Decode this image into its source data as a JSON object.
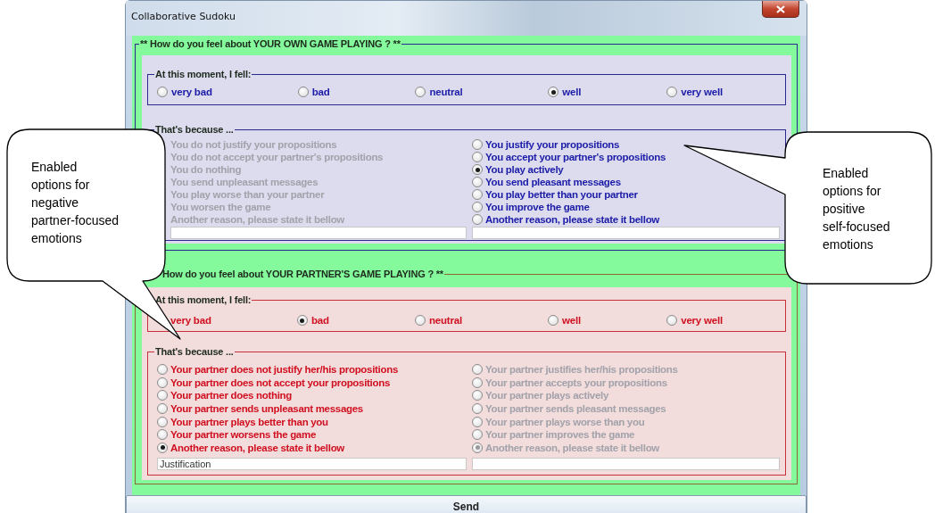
{
  "window": {
    "title": "Collaborative Sudoku"
  },
  "sections": [
    {
      "kind": "own",
      "title": "** How do you feel about YOUR OWN GAME PLAYING ?  **",
      "feeling": {
        "title": "At this moment, I fell:",
        "options": [
          {
            "label": "very bad",
            "selected": false
          },
          {
            "label": "bad",
            "selected": false
          },
          {
            "label": "neutral",
            "selected": false
          },
          {
            "label": "well",
            "selected": true
          },
          {
            "label": "very well",
            "selected": false
          }
        ]
      },
      "reasons": {
        "title": "That's because ...",
        "columns": [
          {
            "items": [
              {
                "label": "You do not justify your propositions",
                "enabled": false
              },
              {
                "label": "You do not accept your partner's propositions",
                "enabled": false
              },
              {
                "label": "You do nothing",
                "enabled": false
              },
              {
                "label": "You send unpleasant messages",
                "enabled": false
              },
              {
                "label": "You play worse than your partner",
                "enabled": false
              },
              {
                "label": "You worsen the game",
                "enabled": false
              },
              {
                "label": "Another reason, please state it bellow",
                "enabled": false
              }
            ]
          },
          {
            "items": [
              {
                "label": "You justify your propositions",
                "enabled": true,
                "selected": false
              },
              {
                "label": "You accept your partner's propositions",
                "enabled": true,
                "selected": false
              },
              {
                "label": "You play actively",
                "enabled": true,
                "selected": true
              },
              {
                "label": "You send pleasant messages",
                "enabled": true,
                "selected": false
              },
              {
                "label": "You play better than your partner",
                "enabled": true,
                "selected": false
              },
              {
                "label": "You improve the game",
                "enabled": true,
                "selected": false
              },
              {
                "label": "Another reason, please state it bellow",
                "enabled": true,
                "selected": false
              }
            ]
          }
        ]
      }
    },
    {
      "kind": "partner",
      "title": "How do you feel about YOUR PARTNER'S GAME PLAYING ?  **",
      "feeling": {
        "title": "At this moment, I fell:",
        "options": [
          {
            "label": "very bad"
          },
          {
            "label": "bad",
            "selected": true
          },
          {
            "label": "neutral",
            "selected": false
          },
          {
            "label": "well",
            "selected": false
          },
          {
            "label": "very well",
            "selected": false
          }
        ]
      },
      "reasons": {
        "title": "That's because ...",
        "columns": [
          {
            "items": [
              {
                "label": "Your partner does not justify her/his propositions",
                "enabled": true,
                "selected": false
              },
              {
                "label": "Your partner does not accept your propositions",
                "enabled": true,
                "selected": false
              },
              {
                "label": "Your partner does nothing",
                "enabled": true,
                "selected": false
              },
              {
                "label": "Your partner sends unpleasant messages",
                "enabled": true,
                "selected": false
              },
              {
                "label": "Your partner plays better than you",
                "enabled": true,
                "selected": false
              },
              {
                "label": "Your partner worsens the game",
                "enabled": true,
                "selected": false
              },
              {
                "label": "Another reason, please state it bellow",
                "enabled": true,
                "selected": true
              }
            ],
            "field": {
              "value": "Justification"
            }
          },
          {
            "items": [
              {
                "label": "Your partner justifies her/his propositions",
                "enabled": false,
                "selected": false
              },
              {
                "label": "Your partner accepts your propositions",
                "enabled": false,
                "selected": false
              },
              {
                "label": "Your partner plays actively",
                "enabled": false,
                "selected": false
              },
              {
                "label": "Your partner sends pleasant messages",
                "enabled": false,
                "selected": false
              },
              {
                "label": "Your partner plays worse than you",
                "enabled": false,
                "selected": false
              },
              {
                "label": "Your partner improves the game",
                "enabled": false,
                "selected": false
              },
              {
                "label": "Another reason, please state it bellow",
                "enabled": false,
                "selected": true
              }
            ]
          }
        ]
      }
    }
  ],
  "send_button": "Send",
  "callouts": [
    {
      "text": "Enabled\noptions for\nnegative\npartner-focused\nemotions"
    },
    {
      "text": "Enabled\noptions for\npositive\nself-focused\nemotions"
    }
  ]
}
